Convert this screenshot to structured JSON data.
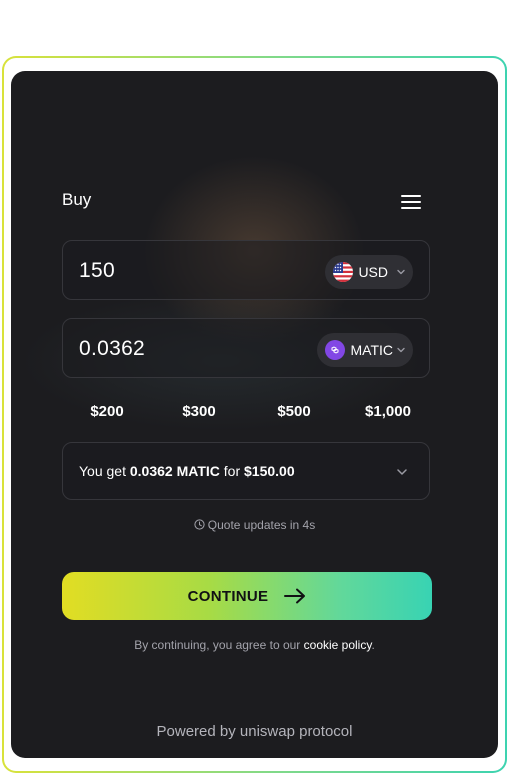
{
  "widget": {
    "title": "Buy",
    "menu_icon": "hamburger-menu-icon"
  },
  "fiat_input": {
    "value": "150",
    "currency_code": "USD",
    "currency_icon": "us-flag-icon"
  },
  "crypto_output": {
    "value": "0.0362",
    "currency_code": "MATIC",
    "currency_icon": "polygon-matic-icon",
    "icon_color": "#8247e5"
  },
  "presets": [
    "$200",
    "$300",
    "$500",
    "$1,000"
  ],
  "summary": {
    "prefix": "You get ",
    "amount": "0.0362 MATIC",
    "middle": " for ",
    "price": "$150.00"
  },
  "quote_timer": {
    "icon": "clock-icon",
    "text": "Quote updates in 4s"
  },
  "continue_button": {
    "label": "CONTINUE",
    "icon": "arrow-right-icon"
  },
  "terms": {
    "prefix": "By continuing, you agree to our ",
    "link_label": "cookie policy",
    "suffix": "."
  },
  "footer": {
    "powered_by": "Powered by uniswap protocol"
  },
  "colors": {
    "background": "#1c1c1f",
    "accent_gradient_start": "#e2dd23",
    "accent_gradient_end": "#38d3b3",
    "border": "#36363b"
  }
}
